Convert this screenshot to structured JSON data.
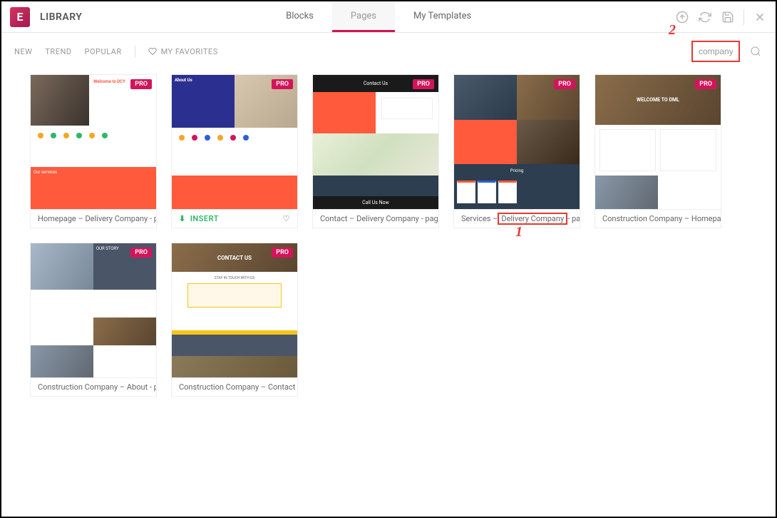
{
  "header": {
    "title": "LIBRARY",
    "tabs": {
      "blocks": "Blocks",
      "pages": "Pages",
      "my_templates": "My Templates"
    }
  },
  "filters": {
    "new": "NEW",
    "trend": "TREND",
    "popular": "POPULAR",
    "favorites": "MY FAVORITES"
  },
  "search": {
    "value": "company"
  },
  "annotations": {
    "one": "1",
    "two": "2"
  },
  "badges": {
    "pro": "PRO"
  },
  "templates": [
    {
      "title": "Homepage – Delivery Company - p...",
      "pro": true
    },
    {
      "title": "INSERT",
      "pro": true,
      "insert": true
    },
    {
      "title": "Contact – Delivery Company - page",
      "pro": true
    },
    {
      "title_pre": "Services – ",
      "title_highlight": "Delivery Company",
      "title_post": " - page",
      "pro": true,
      "highlighted": true
    },
    {
      "title": "Construction Company – Homepa...",
      "pro": true
    },
    {
      "title": "Construction Company – About - p...",
      "pro": true
    },
    {
      "title": "Construction Company – Contact - ...",
      "pro": true
    }
  ],
  "thumb_text": {
    "welcome_dcy": "Welcome to DCY",
    "about_us": "About Us",
    "contact_us": "Contact Us",
    "call_now": "Call Us Now",
    "contact_us_big": "CONTACT US",
    "stay_in_touch": "STAY IN TOUCH WITH US",
    "our_story": "OUR STORY",
    "welcome_dml": "WELCOME TO DML",
    "pricing": "Pricing"
  }
}
